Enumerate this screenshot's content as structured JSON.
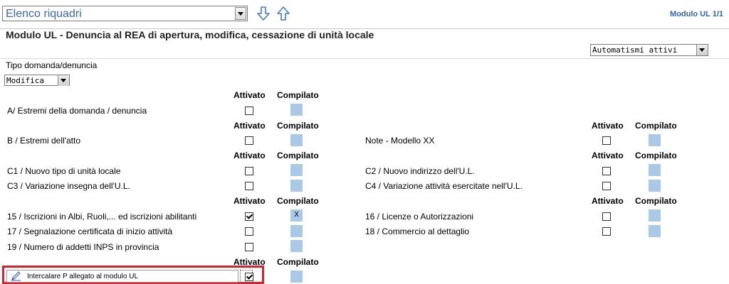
{
  "top": {
    "select_value": "Elenco riquadri",
    "module_info": "Modulo UL 1/1"
  },
  "page_title": "Modulo UL - Denuncia al REA di apertura, modifica, cessazione di unità locale",
  "automatismi": {
    "value": "Automatismi attivi"
  },
  "tipo": {
    "label": "Tipo domanda/denuncia",
    "value": "Modifica"
  },
  "headers": {
    "attivato": "Attivato",
    "compilato": "Compilato"
  },
  "rows": {
    "a": {
      "label": "A/ Estremi della domanda / denuncia",
      "checked": false,
      "compiled": ""
    },
    "b": {
      "label": "B / Estremi dell'atto",
      "checked": false,
      "compiled": ""
    },
    "note": {
      "label": "Note - Modello XX",
      "checked": false,
      "compiled": ""
    },
    "c1": {
      "label": "C1 / Nuovo tipo di unità locale",
      "checked": false,
      "compiled": ""
    },
    "c2": {
      "label": "C2 / Nuovo indirizzo dell'U.L.",
      "checked": false,
      "compiled": ""
    },
    "c3": {
      "label": "C3 / Variazione insegna dell'U.L.",
      "checked": false,
      "compiled": ""
    },
    "c4": {
      "label": "C4 / Variazione attività esercitate nell'U.L.",
      "checked": false,
      "compiled": ""
    },
    "r15": {
      "label": "15 / Iscrizioni in Albi, Ruoli,... ed iscrizioni abilitanti",
      "checked": true,
      "compiled": "X"
    },
    "r16": {
      "label": "16 / Licenze o Autorizzazioni",
      "checked": false,
      "compiled": ""
    },
    "r17": {
      "label": "17 / Segnalazione certificata di inizio attività",
      "checked": false,
      "compiled": ""
    },
    "r18": {
      "label": "18 / Commercio al dettaglio",
      "checked": false,
      "compiled": ""
    },
    "r19": {
      "label": "19 / Numero di addetti INPS in provincia",
      "checked": false,
      "compiled": ""
    },
    "p": {
      "label": "Intercalare P allegato al modulo UL",
      "checked": true,
      "compiled": ""
    }
  },
  "icons": [
    "arrow-down-icon",
    "arrow-up-icon",
    "pencil-icon",
    "chevron-down-icon",
    "checkmark-icon"
  ],
  "colors": {
    "accent": "#2a63c4",
    "compiled_fill": "#a9c9e8",
    "highlight": "#e0202a"
  }
}
